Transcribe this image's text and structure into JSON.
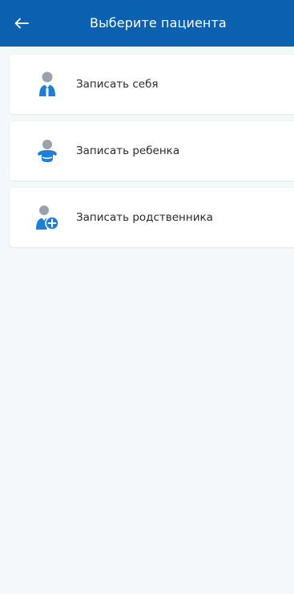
{
  "header": {
    "title": "Выберите пациента",
    "back_icon": "arrow-left-icon",
    "background_color": "#0b60b0",
    "text_color": "#ffffff"
  },
  "options": [
    {
      "label": "Записать себя",
      "icon": "user-self-icon"
    },
    {
      "label": "Записать ребенка",
      "icon": "child-icon"
    },
    {
      "label": "Записать родственника",
      "icon": "add-relative-icon"
    }
  ],
  "colors": {
    "accent_blue": "#1e7fd4",
    "icon_gray": "#9aa3ad",
    "page_background": "#f5f8fb"
  }
}
